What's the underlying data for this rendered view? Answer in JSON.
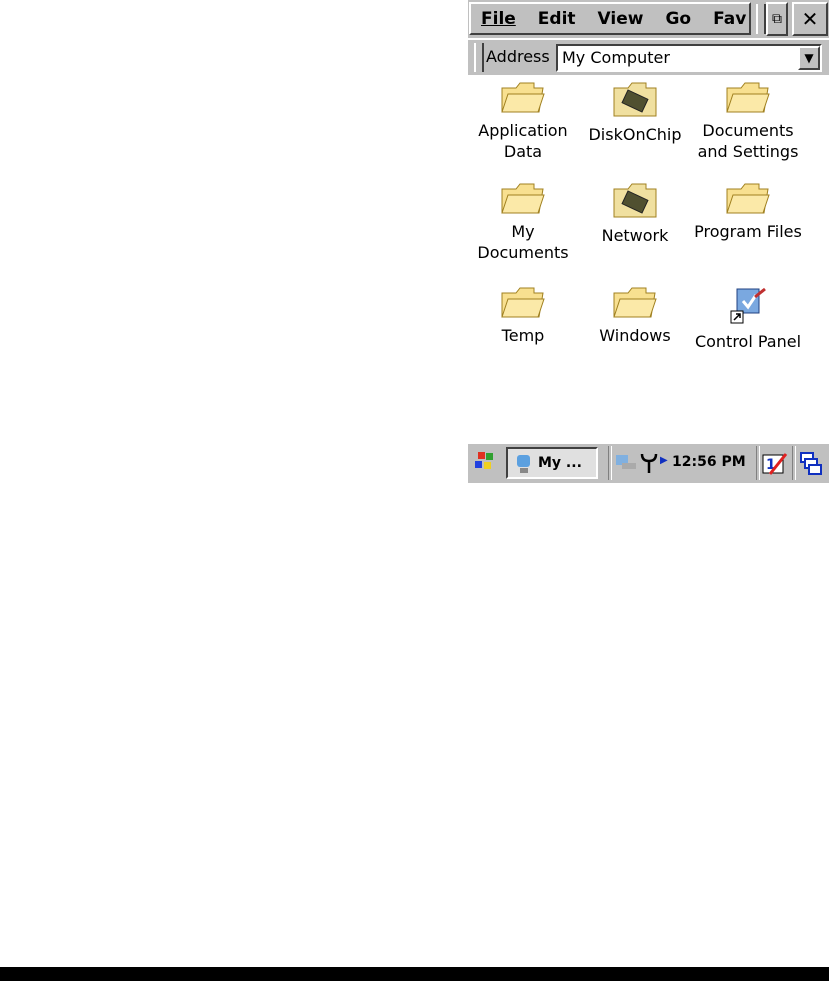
{
  "menu": {
    "items": [
      "File",
      "Edit",
      "View",
      "Go",
      "Fav"
    ]
  },
  "address": {
    "label": "Address",
    "value": "My Computer"
  },
  "items": [
    {
      "label": "Application Data",
      "type": "folder"
    },
    {
      "label": "DiskOnChip",
      "type": "storage"
    },
    {
      "label": "Documents and Settings",
      "type": "folder"
    },
    {
      "label": "My Documents",
      "type": "folder"
    },
    {
      "label": "Network",
      "type": "storage"
    },
    {
      "label": "Program Files",
      "type": "folder"
    },
    {
      "label": "Temp",
      "type": "folder"
    },
    {
      "label": "Windows",
      "type": "folder"
    },
    {
      "label": "Control Panel",
      "type": "shortcut"
    }
  ],
  "taskbar": {
    "task_label": "My ...",
    "clock": "12:56 PM"
  }
}
